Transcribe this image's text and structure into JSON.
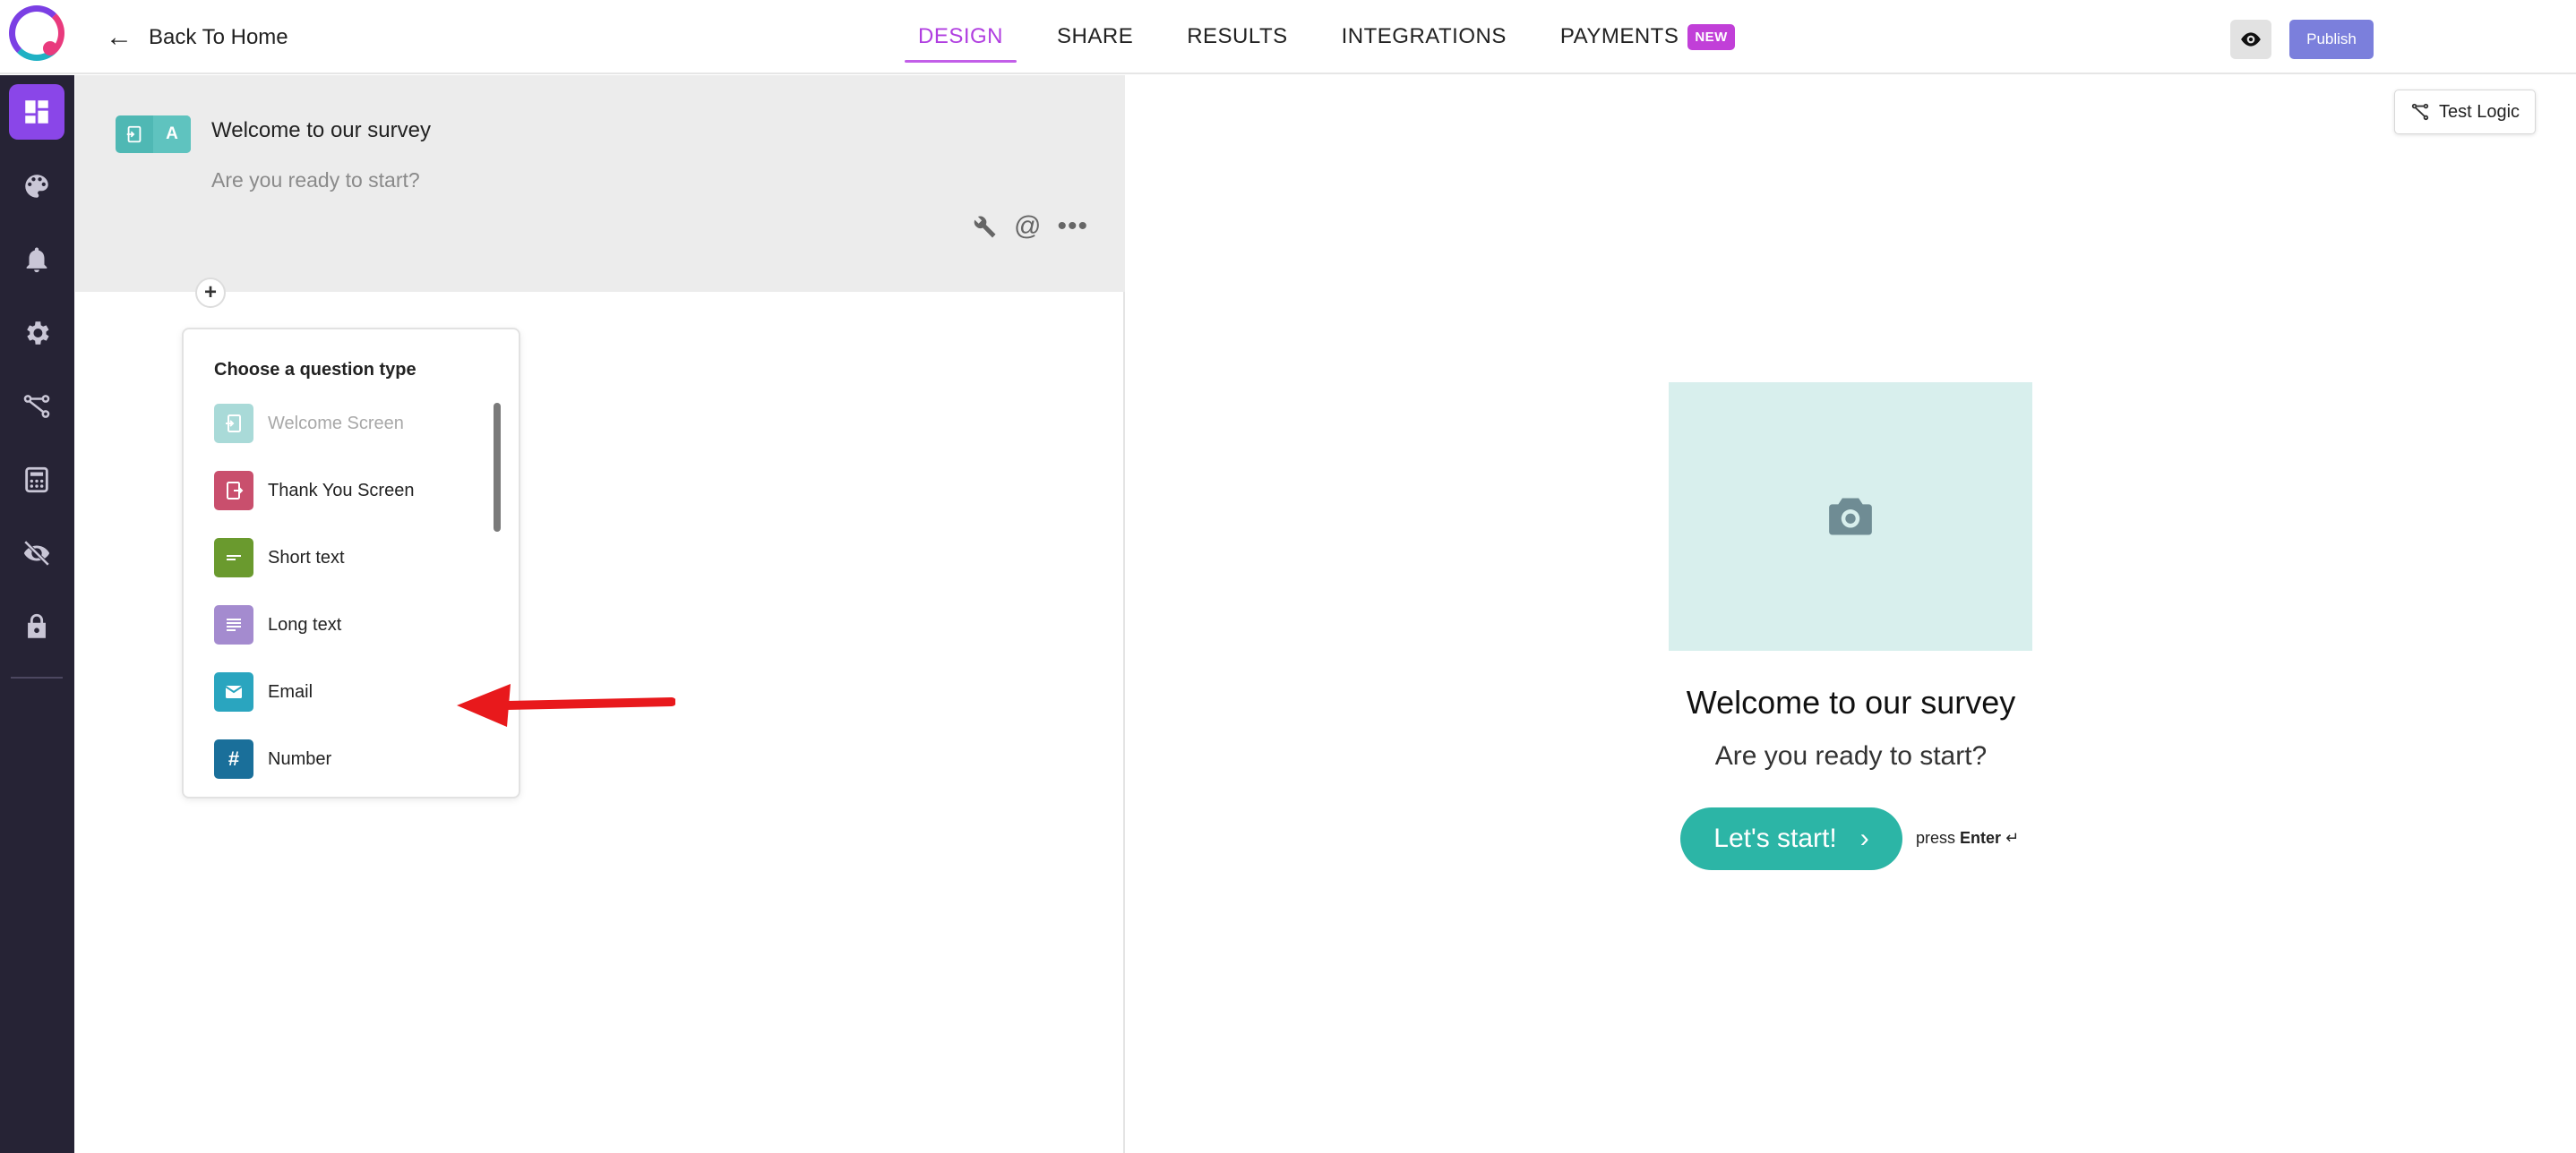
{
  "header": {
    "back_label": "Back To Home",
    "tabs": [
      {
        "label": "DESIGN",
        "active": true
      },
      {
        "label": "SHARE",
        "active": false
      },
      {
        "label": "RESULTS",
        "active": false
      },
      {
        "label": "INTEGRATIONS",
        "active": false
      },
      {
        "label": "PAYMENTS",
        "active": false,
        "badge": "NEW"
      }
    ],
    "preview_icon": "eye-icon",
    "publish_label": "Publish"
  },
  "sidebar": {
    "items": [
      {
        "icon": "dashboard-icon",
        "active": true
      },
      {
        "icon": "palette-icon",
        "active": false
      },
      {
        "icon": "bell-icon",
        "active": false
      },
      {
        "icon": "gear-icon",
        "active": false
      },
      {
        "icon": "logic-flow-icon",
        "active": false
      },
      {
        "icon": "calculator-icon",
        "active": false
      },
      {
        "icon": "hidden-eye-icon",
        "active": false
      },
      {
        "icon": "lock-icon",
        "active": false
      }
    ]
  },
  "editor": {
    "welcome_block": {
      "badge_letter": "A",
      "title": "Welcome to our survey",
      "subtitle": "Are you ready to start?"
    },
    "add_symbol": "+",
    "question_types": {
      "title": "Choose a question type",
      "items": [
        {
          "label": "Welcome Screen",
          "color": "#a9dad8",
          "icon": "welcome-screen-icon",
          "disabled": true
        },
        {
          "label": "Thank You Screen",
          "color": "#c94f6d",
          "icon": "thank-you-screen-icon",
          "disabled": false
        },
        {
          "label": "Short text",
          "color": "#6a9a2e",
          "icon": "short-text-icon",
          "disabled": false
        },
        {
          "label": "Long text",
          "color": "#a48bcf",
          "icon": "long-text-icon",
          "disabled": false
        },
        {
          "label": "Email",
          "color": "#2aa5bf",
          "icon": "email-icon",
          "disabled": false
        },
        {
          "label": "Number",
          "color": "#1a6f9a",
          "icon": "number-icon",
          "glyph": "#",
          "disabled": false
        }
      ]
    }
  },
  "preview": {
    "test_logic_label": "Test Logic",
    "title": "Welcome to our survey",
    "subtitle": "Are you ready to start?",
    "start_label": "Let's start!",
    "press_label": "press",
    "enter_label": "Enter",
    "enter_symbol": "↵"
  },
  "colors": {
    "sidebar_bg": "#262335",
    "accent": "#8a46e8",
    "active_tab": "#b03ee0",
    "publish": "#7b7fdc",
    "start_button": "#2cb5a6",
    "image_placeholder": "#d8efed"
  }
}
